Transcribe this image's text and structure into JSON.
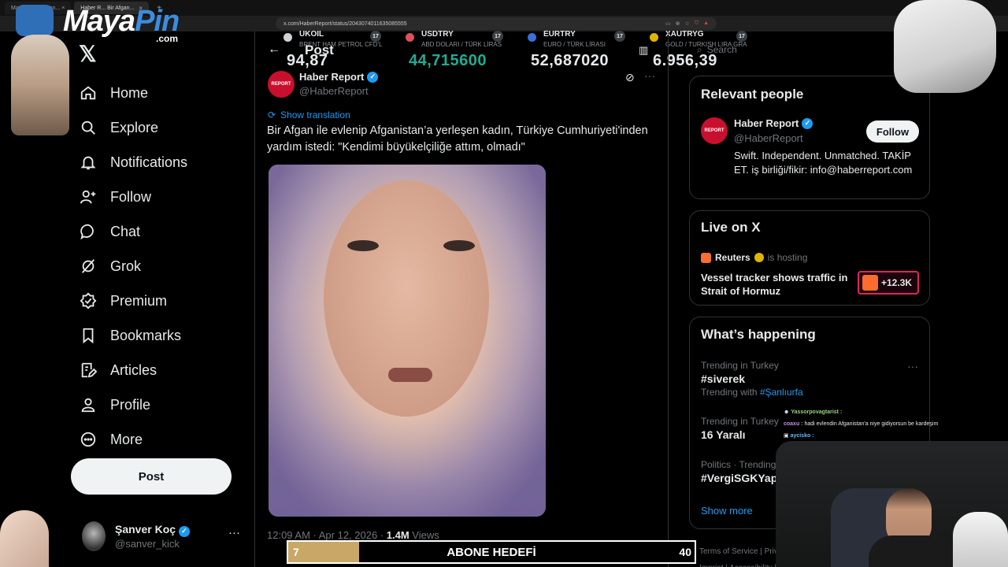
{
  "browser": {
    "tabs": [
      {
        "label": "Ma... haber yapan... ×",
        "active": false
      },
      {
        "label": "Haber R... Bir Afgan...",
        "active": true
      }
    ],
    "tab_close": "×",
    "new_tab": "+",
    "url": "x.com/HaberReport/status/2043074011635085555"
  },
  "ticker": [
    {
      "name": "UKOIL",
      "desc": "BRENT HAM PETROL CFD'L",
      "value": "94,87",
      "color": "#e7e9ea",
      "dot": "#cfd3d6"
    },
    {
      "name": "USDTRY",
      "desc": "ABD DOLARI / TÜRK LİRAS",
      "value": "44,715600",
      "color": "#22ab94",
      "dot": "#e04f5f"
    },
    {
      "name": "EURTRY",
      "desc": "EURO / TÜRK LİRASI",
      "value": "52,687020",
      "color": "#e7e9ea",
      "dot": "#3b6fd8"
    },
    {
      "name": "XAUTRYG",
      "desc": "GOLD / TURKISH LIRA GRA",
      "value": "6.956,39",
      "color": "#e7e9ea",
      "dot": "#e0b500"
    }
  ],
  "ticker_logo": "17",
  "overlay_logo": {
    "main": "Maya",
    "accent": "Pin",
    "suffix": ".com"
  },
  "nav": {
    "logo": "𝕏",
    "items": [
      {
        "label": "Home",
        "icon": "home-icon"
      },
      {
        "label": "Explore",
        "icon": "search-icon"
      },
      {
        "label": "Notifications",
        "icon": "bell-icon"
      },
      {
        "label": "Follow",
        "icon": "person-add-icon"
      },
      {
        "label": "Chat",
        "icon": "chat-icon"
      },
      {
        "label": "Grok",
        "icon": "grok-icon"
      },
      {
        "label": "Premium",
        "icon": "premium-icon"
      },
      {
        "label": "Bookmarks",
        "icon": "bookmark-icon"
      },
      {
        "label": "Articles",
        "icon": "articles-icon"
      },
      {
        "label": "Profile",
        "icon": "profile-icon"
      },
      {
        "label": "More",
        "icon": "more-circle-icon"
      }
    ],
    "post_button": "Post"
  },
  "account": {
    "name": "Şanver Koç",
    "handle": "@sanver_kick",
    "more": "···"
  },
  "post": {
    "header_title": "Post",
    "back": "←",
    "author_name": "Haber Report",
    "author_handle": "@HaberReport",
    "avatar_text": "REPORT",
    "show_translation": "Show translation",
    "text": "Bir Afgan ile evlenip Afganistan’a yerleşen kadın, Türkiye Cumhuriyeti'inden yardım istedi: \"Kendimi büyükelçiliğe attım, olmadı\"",
    "time": "12:09 AM · Apr 12, 2026 · ",
    "views_count": "1.4M",
    "views_label": " Views"
  },
  "search": {
    "placeholder": "Search"
  },
  "relevant_people": {
    "title": "Relevant people",
    "name": "Haber Report",
    "handle": "@HaberReport",
    "follow": "Follow",
    "bio": "Swift. Independent. Unmatched. TAKİP ET. iş birliği/fikir: info@haberreport.com"
  },
  "live": {
    "title": "Live on X",
    "host": "Reuters",
    "hosting": "is hosting",
    "headline": "Vessel tracker shows traffic in Strait of Hormuz",
    "count": "+12.3K"
  },
  "happening": {
    "title": "What’s happening",
    "trends": [
      {
        "meta": "Trending in Turkey",
        "name": "#siverek",
        "with_label": "Trending with ",
        "with_tag": "#Şanlıurfa"
      },
      {
        "meta": "Trending in Turkey",
        "name": "16 Yaralı",
        "with_label": "",
        "with_tag": ""
      },
      {
        "meta": "Politics · Trending",
        "name": "#VergiSGKYap...",
        "with_label": "",
        "with_tag": ""
      }
    ],
    "more_dots": "···",
    "show_more": "Show more"
  },
  "footer": {
    "line1": "Terms of Service  |  Privacy Policy  |  Cookie Policy",
    "line2": "Imprint  |  Accessibility  |  Ads info"
  },
  "chat": [
    {
      "user": "Yassorpovagtarist :",
      "message": "",
      "usercls": "chat-user1"
    },
    {
      "user": "coaxu :",
      "message": " hadi evlendin Afganistan'a niye gidiyorsun be kardeşim",
      "usercls": "chat-user2"
    },
    {
      "user": "aycisko :",
      "message": "",
      "usercls": "chat-user3"
    }
  ],
  "goal": {
    "current": "7",
    "label": "ABONE HEDEFİ",
    "target": "40",
    "progress": 0.175
  }
}
